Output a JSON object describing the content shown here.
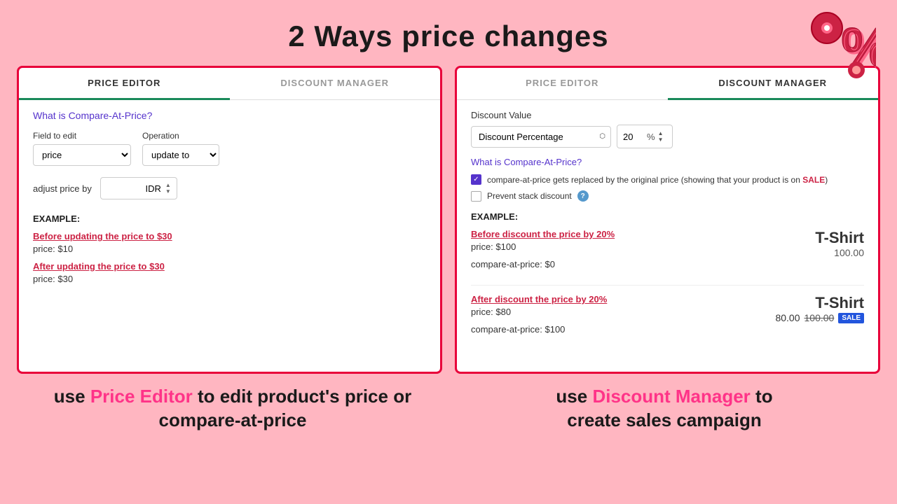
{
  "header": {
    "title": "2 Ways price changes"
  },
  "percent_icon": "%",
  "left_panel": {
    "tabs": [
      {
        "label": "PRICE EDITOR",
        "active": true
      },
      {
        "label": "DISCOUNT MANAGER",
        "active": false
      }
    ],
    "link": "What is Compare-At-Price?",
    "field_to_edit_label": "Field to edit",
    "field_to_edit_value": "price",
    "operation_label": "Operation",
    "operation_value": "update to",
    "adjust_label": "adjust price by",
    "adjust_value": "",
    "adjust_currency": "IDR",
    "example_label": "EXAMPLE:",
    "before_link": "Before updating the price to $30",
    "before_price": "price:  $10",
    "after_link": "After updating the price to $30",
    "after_price": "price:  $30"
  },
  "right_panel": {
    "tabs": [
      {
        "label": "PRICE EDITOR",
        "active": false
      },
      {
        "label": "DISCOUNT MANAGER",
        "active": true
      }
    ],
    "discount_value_label": "Discount Value",
    "discount_type": "Discount Percentage",
    "discount_number": "20",
    "discount_symbol": "%",
    "link": "What is Compare-At-Price?",
    "checkbox1_checked": true,
    "checkbox1_text_before": "compare-at-price gets replaced by the original price (showing that your product is on ",
    "checkbox1_sale": "SALE",
    "checkbox1_text_after": ")",
    "checkbox2_checked": false,
    "checkbox2_text": "Prevent stack discount",
    "example_label": "EXAMPLE:",
    "before_discount_link": "Before discount the price by 20%",
    "before_price_line": "price:  $100",
    "before_compare_line": "compare-at-price:  $0",
    "before_tshirt_title": "T-Shirt",
    "before_tshirt_price": "100.00",
    "after_discount_link": "After discount the price by 20%",
    "after_price_line": "price:  $80",
    "after_compare_line": "compare-at-price:  $100",
    "after_tshirt_title": "T-Shirt",
    "after_tshirt_price_new": "80.00",
    "after_tshirt_price_old": "100.00",
    "sale_tag": "SALE"
  },
  "bottom": {
    "left_text1": "use ",
    "left_highlight": "Price Editor",
    "left_text2": " to edit product's price or",
    "left_text3": "compare-at-price",
    "right_text1": "use ",
    "right_highlight": "Discount Manager",
    "right_text2": " to",
    "right_text3": "create sales campaign"
  }
}
